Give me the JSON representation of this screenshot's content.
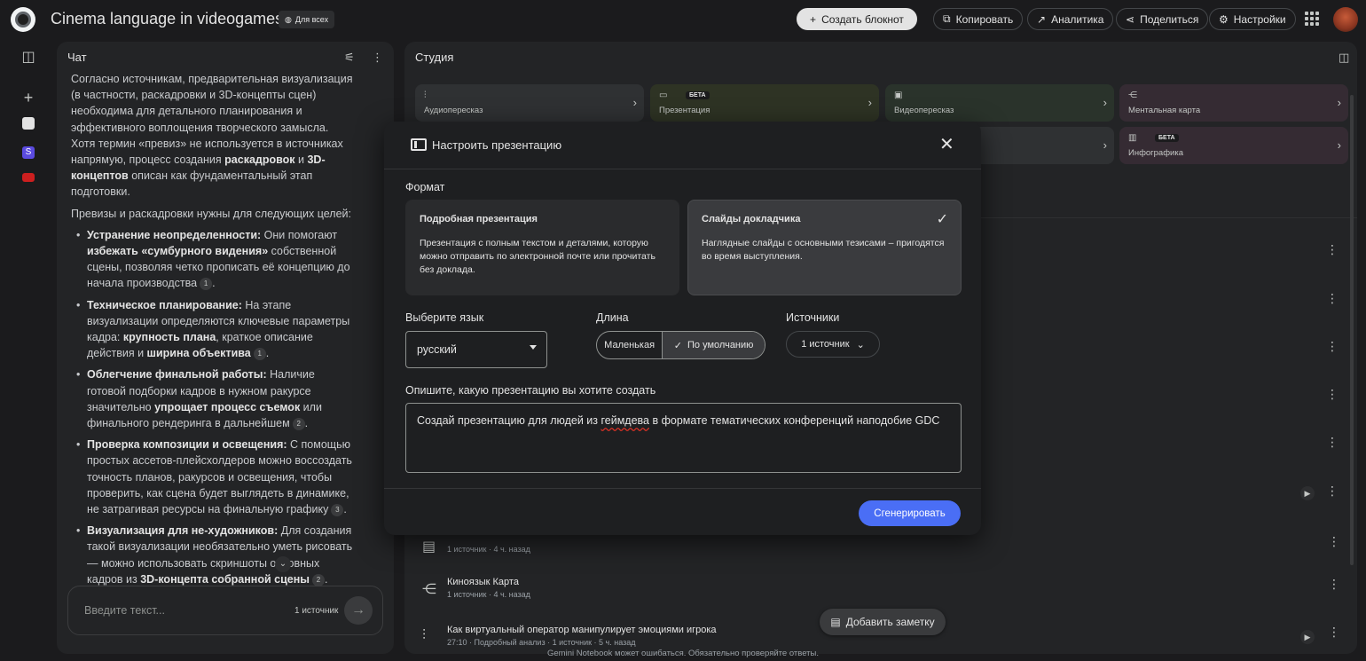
{
  "header": {
    "title": "Cinema language in videogames",
    "visibility": "Для всех",
    "create_notebook": "Создать блокнот",
    "copy": "Копировать",
    "analytics": "Аналитика",
    "share": "Поделиться",
    "settings": "Настройки"
  },
  "chat": {
    "title": "Чат",
    "p1_a": "Согласно источникам, предварительная визуализация (в частности, раскадровки и 3D-концепты сцен) необходима для детального планирования и эффективного воплощения творческого замысла. Хотя термин «превиз» не используется в источниках напрямую, процесс создания ",
    "p1_b1": "раскадровок",
    "p1_c": " и ",
    "p1_b2": "3D-концептов",
    "p1_d": " описан как фундаментальный этап подготовки.",
    "p2": "Превизы и раскадровки нужны для следующих целей:",
    "bullets": [
      {
        "head": "Устранение неопределенности:",
        "t1": " Они помогают ",
        "b1": "избежать «сумбурного видения»",
        "t2": " собственной сцены, позволяя четко прописать её концепцию до начала производства",
        "cite": "1",
        "t3": "."
      },
      {
        "head": "Техническое планирование:",
        "t1": " На этапе визуализации определяются ключевые параметры кадра: ",
        "b1": "крупность плана",
        "t2": ", краткое описание действия и ",
        "b2": "ширина объектива",
        "cite": "1",
        "t3": "."
      },
      {
        "head": "Облегчение финальной работы:",
        "t1": " Наличие готовой подборки кадров в нужном ракурсе значительно ",
        "b1": "упрощает процесс съемок",
        "t2": " или финального рендеринга в дальнейшем",
        "cite": "2",
        "t3": "."
      },
      {
        "head": "Проверка композиции и освещения:",
        "t1": " С помощью простых ассетов-плейсхолдеров можно воссоздать точность планов, ракурсов и освещения, чтобы проверить, как сцена будет выглядеть в динамике, не затрагивая ресурсы на финальную графику",
        "cite": "3",
        "t3": "."
      },
      {
        "head": "Визуализация для не-художников:",
        "t1": " Для создания такой визуализации необязательно уметь рисовать — можно использовать скриншоты основных кадров из ",
        "b1": "3D-концепта собранной сцены",
        "cite": "2",
        "t3": "."
      }
    ],
    "input_placeholder": "Введите текст...",
    "input_sources": "1 источник"
  },
  "studio": {
    "title": "Студия",
    "tiles": [
      {
        "label": "Аудиопересказ",
        "beta": ""
      },
      {
        "label": "Презентация",
        "beta": "БЕТА"
      },
      {
        "label": "Видеопересказ",
        "beta": ""
      },
      {
        "label": "Ментальная карта",
        "beta": ""
      },
      {
        "label": "Инфографика",
        "beta": "БЕТА"
      }
    ],
    "items": [
      {
        "title": "",
        "meta": "1 источник · 4 ч. назад"
      },
      {
        "title": "Киноязык Карта",
        "meta": "1 источник · 4 ч. назад"
      },
      {
        "title": "Как виртуальный оператор манипулирует эмоциями игрока",
        "meta": "27:10 · Подробный анализ · 1 источник · 5 ч. назад"
      }
    ],
    "add_note": "Добавить заметку",
    "footer": "Gemini Notebook может ошибаться. Обязательно проверяйте ответы."
  },
  "dialog": {
    "title": "Настроить презентацию",
    "format_label": "Формат",
    "formats": [
      {
        "title": "Подробная презентация",
        "desc": "Презентация с полным текстом и деталями, которую можно отправить по электронной почте или прочитать без доклада.",
        "selected": false
      },
      {
        "title": "Слайды докладчика",
        "desc": "Наглядные слайды с основными тезисами – пригодятся во время выступления.",
        "selected": true
      }
    ],
    "language_label": "Выберите язык",
    "language_value": "русский",
    "length_label": "Длина",
    "length_options": [
      "Маленькая",
      "По умолчанию"
    ],
    "length_selected": "По умолчанию",
    "sources_label": "Источники",
    "sources_value": "1 источник",
    "prompt_label": "Опишите, какую презентацию вы хотите создать",
    "prompt_a": "Создай презентацию для людей из ",
    "prompt_b": "геймдева",
    "prompt_c": " в формате тематических конференций наподобие GDC",
    "generate": "Сгенерировать"
  },
  "colors": {
    "accent": "#4a6ef5",
    "bg": "#1b1b1d",
    "panel": "#232426",
    "dialog": "#1e1f21"
  }
}
